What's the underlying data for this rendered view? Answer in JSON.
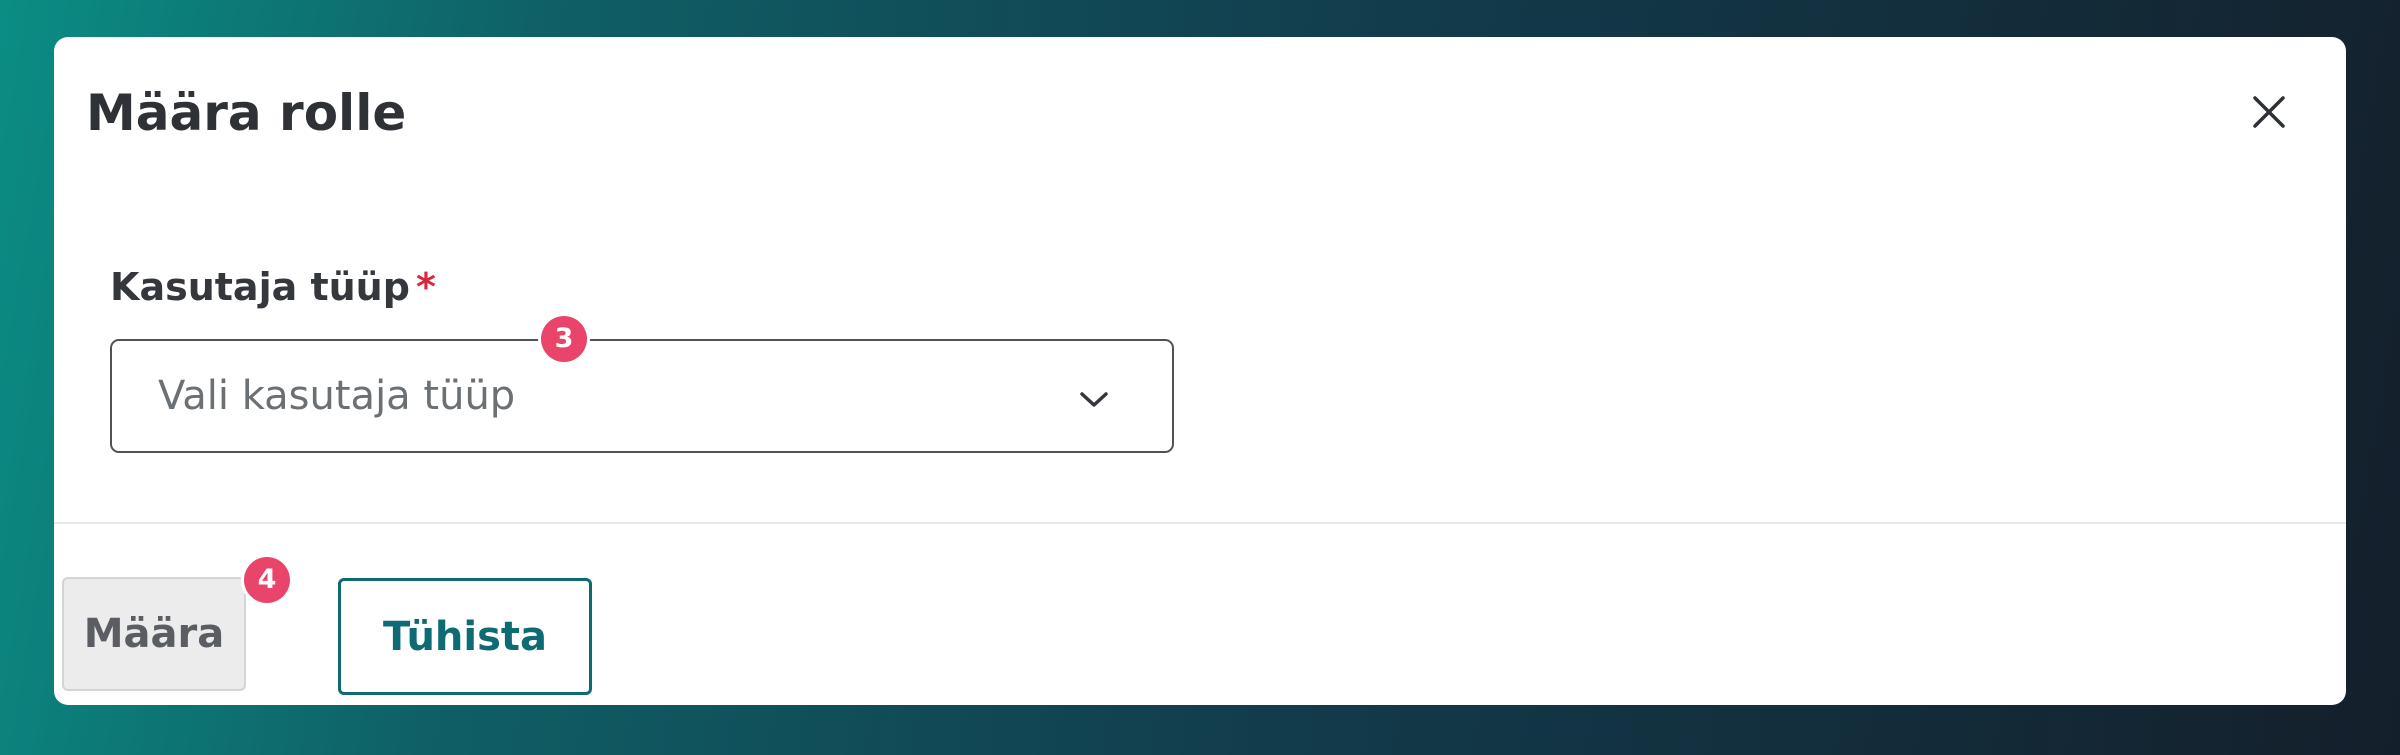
{
  "dialog": {
    "title": "Määra rolle",
    "close_label": "Close"
  },
  "form": {
    "user_type": {
      "label": "Kasutaja tüüp",
      "required_mark": "*",
      "placeholder": "Vali kasutaja tüüp"
    }
  },
  "badges": {
    "step_3": "3",
    "step_4": "4"
  },
  "footer": {
    "assign_label": "Määra",
    "cancel_label": "Tühista"
  },
  "colors": {
    "accent": "#0e6b74",
    "required": "#d7263d",
    "badge": "#e9456b",
    "disabled_button_bg": "#ececec"
  },
  "icons": {
    "close": "close-icon",
    "dropdown": "chevron-down-icon"
  }
}
